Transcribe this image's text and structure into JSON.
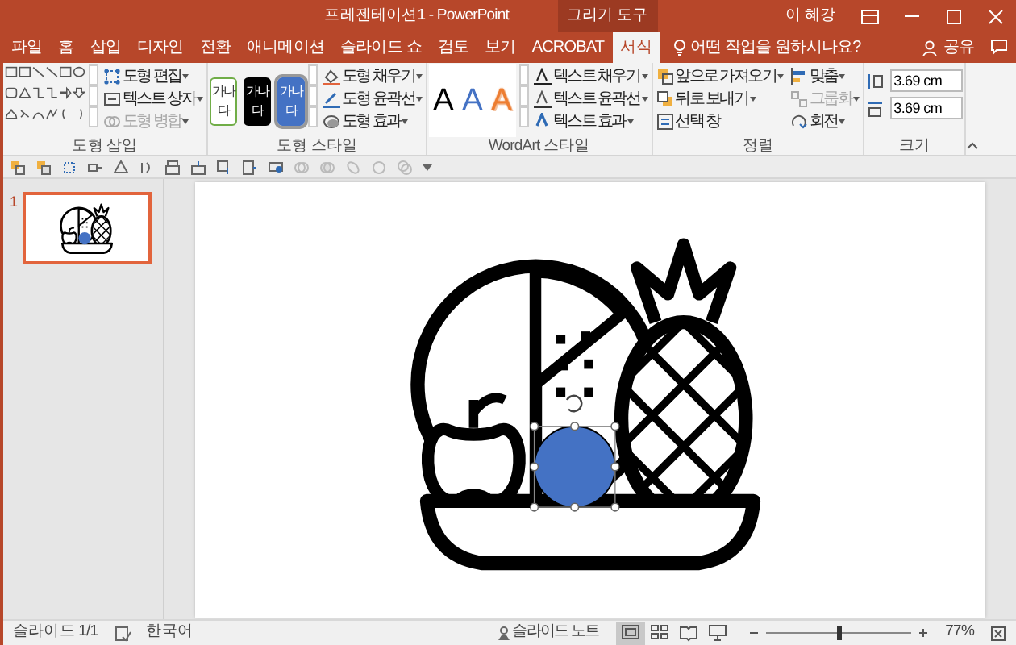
{
  "title_bar": {
    "title": "프레젠테이션1 - PowerPoint",
    "context_label": "그리기 도구",
    "user": "이 혜강"
  },
  "tabs": [
    {
      "label": "파일",
      "selected": false
    },
    {
      "label": "홈",
      "selected": false
    },
    {
      "label": "삽입",
      "selected": false
    },
    {
      "label": "디자인",
      "selected": false
    },
    {
      "label": "전환",
      "selected": false
    },
    {
      "label": "애니메이션",
      "selected": false
    },
    {
      "label": "슬라이드 쇼",
      "selected": false
    },
    {
      "label": "검토",
      "selected": false
    },
    {
      "label": "보기",
      "selected": false
    },
    {
      "label": "ACROBAT",
      "selected": false
    },
    {
      "label": "서식",
      "selected": true
    }
  ],
  "tell_me": {
    "placeholder": "어떤 작업을 원하시나요?"
  },
  "share": "공유",
  "ribbon": {
    "insert_shapes": {
      "label": "도형 삽입",
      "commands": [
        {
          "label": "도형 편집",
          "disabled": false
        },
        {
          "label": "텍스트 상자",
          "disabled": false
        },
        {
          "label": "도형 병합",
          "disabled": true
        }
      ]
    },
    "shape_styles": {
      "label": "도형 스타일",
      "presets": [
        {
          "text": "가나다",
          "kind": "outline",
          "color": "#70ad47",
          "selected": false
        },
        {
          "text": "가나다",
          "kind": "filled",
          "color": "#000000",
          "selected": false
        },
        {
          "text": "가나다",
          "kind": "filled",
          "color": "#4472c4",
          "selected": true
        }
      ],
      "commands": [
        {
          "label": "도형 채우기",
          "disabled": false
        },
        {
          "label": "도형 윤곽선",
          "disabled": false
        },
        {
          "label": "도형 효과",
          "disabled": false
        }
      ]
    },
    "wordart": {
      "label": "WordArt 스타일",
      "presets": [
        {
          "text": "A",
          "kind": "filled",
          "color": "#000000"
        },
        {
          "text": "A",
          "kind": "filled",
          "color": "#4472c4"
        },
        {
          "text": "A",
          "kind": "outline",
          "color": "#ed7d31"
        }
      ],
      "commands": [
        {
          "label": "텍스트 채우기",
          "disabled": false
        },
        {
          "label": "텍스트 윤곽선",
          "disabled": false
        },
        {
          "label": "텍스트 효과",
          "disabled": false
        }
      ]
    },
    "arrange": {
      "label": "정렬",
      "commands": [
        {
          "label": "앞으로 가져오기",
          "disabled": false
        },
        {
          "label": "뒤로 보내기",
          "disabled": false
        },
        {
          "label": "선택 창",
          "disabled": false
        },
        {
          "label": "맞춤",
          "disabled": false
        },
        {
          "label": "그룹화",
          "disabled": true
        },
        {
          "label": "회전",
          "disabled": false
        }
      ]
    },
    "size": {
      "label": "크기",
      "height": "3.69 cm",
      "width": "3.69 cm"
    }
  },
  "thumbnails": [
    {
      "number": "1",
      "selected": true
    }
  ],
  "status_bar": {
    "slide": "슬라이드 1/1",
    "language": "한국어",
    "notes": "슬라이드 노트",
    "views": [
      {
        "kind": "normal",
        "selected": true
      },
      {
        "kind": "sorter",
        "selected": false
      },
      {
        "kind": "reading",
        "selected": false
      },
      {
        "kind": "slideshow",
        "selected": false
      }
    ],
    "zoom": {
      "level": 0.5,
      "reading": "77%"
    }
  }
}
